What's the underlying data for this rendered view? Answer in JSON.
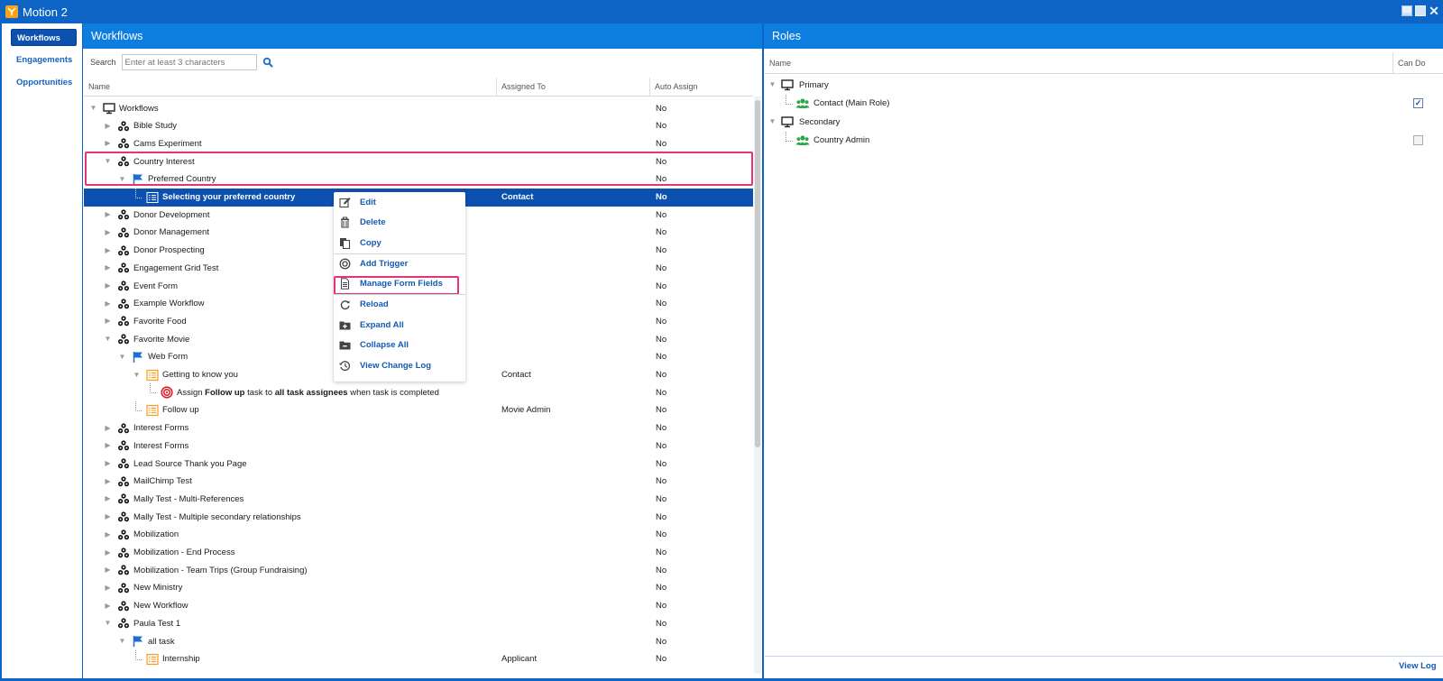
{
  "window": {
    "title": "Motion 2"
  },
  "nav": {
    "items": [
      {
        "label": "Workflows",
        "active": true
      },
      {
        "label": "Engagements",
        "active": false
      },
      {
        "label": "Opportunities",
        "active": false
      }
    ]
  },
  "workflows": {
    "header": "Workflows",
    "search": {
      "label": "Search",
      "placeholder": "Enter at least 3 characters"
    },
    "columns": {
      "name": "Name",
      "assigned": "Assigned To",
      "auto": "Auto Assign"
    }
  },
  "tree": [
    {
      "label": "Workflows",
      "icon": "monitor-icon",
      "level": 0,
      "expanded": true,
      "assigned": "",
      "auto": "No"
    },
    {
      "label": "Bible Study",
      "icon": "workflow-icon",
      "level": 1,
      "expanded": false,
      "assigned": "",
      "auto": "No"
    },
    {
      "label": "Cams Experiment",
      "icon": "workflow-icon",
      "level": 1,
      "expanded": false,
      "assigned": "",
      "auto": "No"
    },
    {
      "label": "Country Interest",
      "icon": "workflow-icon",
      "level": 1,
      "expanded": true,
      "assigned": "",
      "auto": "No"
    },
    {
      "label": "Preferred Country",
      "icon": "flag-icon",
      "level": 2,
      "expanded": true,
      "assigned": "",
      "auto": "No"
    },
    {
      "label": "Selecting your preferred country",
      "icon": "form-icon",
      "level": 3,
      "leaf": true,
      "selected": true,
      "assigned": "Contact",
      "auto": "No"
    },
    {
      "label": "Donor Development",
      "icon": "workflow-icon",
      "level": 1,
      "expanded": false,
      "assigned": "",
      "auto": "No"
    },
    {
      "label": "Donor Management",
      "icon": "workflow-icon",
      "level": 1,
      "expanded": false,
      "assigned": "",
      "auto": "No"
    },
    {
      "label": "Donor Prospecting",
      "icon": "workflow-icon",
      "level": 1,
      "expanded": false,
      "assigned": "",
      "auto": "No"
    },
    {
      "label": "Engagement Grid Test",
      "icon": "workflow-icon",
      "level": 1,
      "expanded": false,
      "assigned": "",
      "auto": "No"
    },
    {
      "label": "Event Form",
      "icon": "workflow-icon",
      "level": 1,
      "expanded": false,
      "assigned": "",
      "auto": "No"
    },
    {
      "label": "Example Workflow",
      "icon": "workflow-icon",
      "level": 1,
      "expanded": false,
      "assigned": "",
      "auto": "No"
    },
    {
      "label": "Favorite Food",
      "icon": "workflow-icon",
      "level": 1,
      "expanded": false,
      "assigned": "",
      "auto": "No"
    },
    {
      "label": "Favorite Movie",
      "icon": "workflow-icon",
      "level": 1,
      "expanded": true,
      "assigned": "",
      "auto": "No"
    },
    {
      "label": "Web Form",
      "icon": "flag-icon",
      "level": 2,
      "expanded": true,
      "assigned": "",
      "auto": "No"
    },
    {
      "label": "Getting to know you",
      "icon": "task-icon",
      "level": 3,
      "expanded": true,
      "assigned": "Contact",
      "auto": "No"
    },
    {
      "label": "",
      "icon": "trigger-icon",
      "level": 4,
      "leaf": true,
      "rich": [
        "Assign ",
        "Follow up",
        " task to ",
        "all task assignees",
        " when task is completed"
      ],
      "assigned": "",
      "auto": "No"
    },
    {
      "label": "Follow up",
      "icon": "task-icon",
      "level": 3,
      "leaf": true,
      "assigned": "Movie Admin",
      "auto": "No"
    },
    {
      "label": "Interest Forms",
      "icon": "workflow-icon",
      "level": 1,
      "expanded": false,
      "assigned": "",
      "auto": "No"
    },
    {
      "label": "Interest Forms",
      "icon": "workflow-icon",
      "level": 1,
      "expanded": false,
      "assigned": "",
      "auto": "No"
    },
    {
      "label": "Lead Source Thank you Page",
      "icon": "workflow-icon",
      "level": 1,
      "expanded": false,
      "assigned": "",
      "auto": "No"
    },
    {
      "label": "MailChimp Test",
      "icon": "workflow-icon",
      "level": 1,
      "expanded": false,
      "assigned": "",
      "auto": "No"
    },
    {
      "label": "Mally Test - Multi-References",
      "icon": "workflow-icon",
      "level": 1,
      "expanded": false,
      "assigned": "",
      "auto": "No"
    },
    {
      "label": "Mally Test - Multiple secondary relationships",
      "icon": "workflow-icon",
      "level": 1,
      "expanded": false,
      "assigned": "",
      "auto": "No"
    },
    {
      "label": "Mobilization",
      "icon": "workflow-icon",
      "level": 1,
      "expanded": false,
      "assigned": "",
      "auto": "No"
    },
    {
      "label": "Mobilization - End Process",
      "icon": "workflow-icon",
      "level": 1,
      "expanded": false,
      "assigned": "",
      "auto": "No"
    },
    {
      "label": "Mobilization - Team Trips (Group Fundraising)",
      "icon": "workflow-icon",
      "level": 1,
      "expanded": false,
      "assigned": "",
      "auto": "No"
    },
    {
      "label": "New Ministry",
      "icon": "workflow-icon",
      "level": 1,
      "expanded": false,
      "assigned": "",
      "auto": "No"
    },
    {
      "label": "New Workflow",
      "icon": "workflow-icon",
      "level": 1,
      "expanded": false,
      "assigned": "",
      "auto": "No"
    },
    {
      "label": "Paula Test 1",
      "icon": "workflow-icon",
      "level": 1,
      "expanded": true,
      "assigned": "",
      "auto": "No"
    },
    {
      "label": "all task",
      "icon": "flag-icon",
      "level": 2,
      "expanded": true,
      "assigned": "",
      "auto": "No"
    },
    {
      "label": "Internship",
      "icon": "task-icon",
      "level": 3,
      "leaf": true,
      "assigned": "Applicant",
      "auto": "No"
    }
  ],
  "context_menu": [
    {
      "label": "Edit",
      "icon": "edit-icon"
    },
    {
      "label": "Delete",
      "icon": "trash-icon"
    },
    {
      "label": "Copy",
      "icon": "copy-icon",
      "separator_after": true
    },
    {
      "label": "Add Trigger",
      "icon": "target-icon"
    },
    {
      "label": "Manage Form Fields",
      "icon": "document-icon",
      "highlighted": true,
      "separator_after": true
    },
    {
      "label": "Reload",
      "icon": "refresh-icon"
    },
    {
      "label": "Expand All",
      "icon": "folder-plus-icon"
    },
    {
      "label": "Collapse All",
      "icon": "folder-minus-icon"
    },
    {
      "label": "View Change Log",
      "icon": "history-icon"
    }
  ],
  "roles": {
    "header": "Roles",
    "columns": {
      "name": "Name",
      "can_do": "Can Do"
    },
    "rows": [
      {
        "label": "Primary",
        "icon": "monitor-icon",
        "level": 0,
        "group": true
      },
      {
        "label": "Contact (Main Role)",
        "icon": "users-icon",
        "level": 1,
        "checked": true
      },
      {
        "label": "Secondary",
        "icon": "monitor-icon",
        "level": 0,
        "group": true
      },
      {
        "label": "Country Admin",
        "icon": "users-icon",
        "level": 1,
        "checked": false
      }
    ],
    "footer_link": "View Log"
  },
  "colors": {
    "primary": "#0d64c4",
    "header": "#0d7ee0",
    "selected": "#0d51b0",
    "highlight": "#e8337a",
    "link": "#1459b5",
    "users_icon": "#2aa84a",
    "form_icon": "#f0a030",
    "trigger_icon": "#d9232e"
  }
}
